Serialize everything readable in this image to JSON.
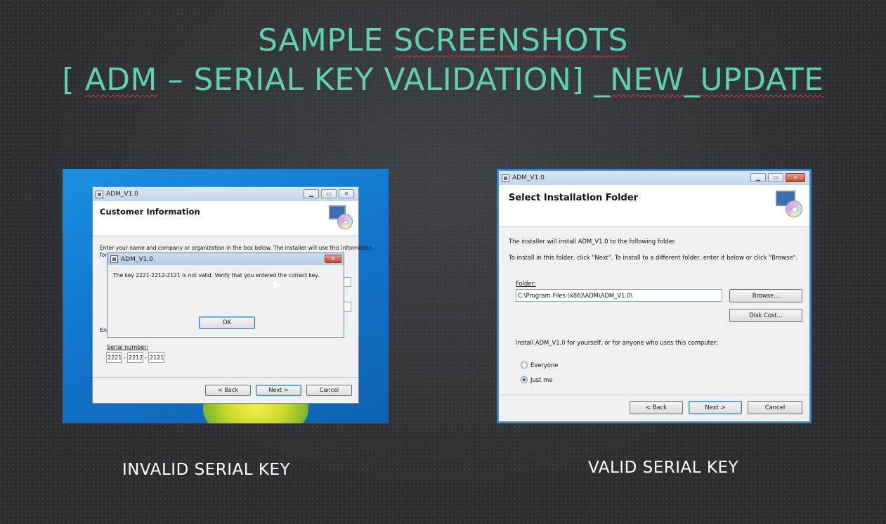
{
  "slide": {
    "title_line1_a": "Sample ",
    "title_line1_b": "Screenshots",
    "title_line2_a": "[ ",
    "title_line2_b": "ADM",
    "title_line2_c": " – Serial Key Validation] _",
    "title_line2_d": "NEW_UPDATE",
    "caption_left": "INVALID SERIAL KEY",
    "caption_right": "VALID SERIAL KEY",
    "accent_color": "#5fd1b3"
  },
  "left_shot": {
    "window_title": "ADM_V1.0",
    "header_title": "Customer Information",
    "intro_text": "Enter your name and company or organization in the box below. The installer will use this information",
    "intro_text_cont": "for",
    "entry_label_stub": "En",
    "serial_label": "Serial number:",
    "serial_parts": [
      "2221",
      "2212",
      "2121"
    ],
    "serial_sep": "-",
    "buttons": {
      "back": "< Back",
      "next": "Next >",
      "cancel": "Cancel"
    },
    "dialog": {
      "title": "ADM_V1.0",
      "message": "The key 2221-2212-2121 is not valid.  Verify that you entered the correct key.",
      "ok": "OK",
      "close_glyph": "✕"
    },
    "caption_buttons": {
      "minimize": "▁",
      "maximize": "▭",
      "close": "✕"
    }
  },
  "right_shot": {
    "window_title": "ADM_V1.0",
    "header_title": "Select Installation Folder",
    "line1": "The installer will install ADM_V1.0 to the following folder.",
    "line2": "To install in this folder, click \"Next\". To install to a different folder, enter it below or click \"Browse\".",
    "folder_label": "Folder:",
    "folder_value": "C:\\Program Files (x86)\\ADM\\ADM_V1.0\\",
    "browse": "Browse...",
    "disk_cost": "Disk Cost...",
    "install_for": "Install ADM_V1.0 for yourself, or for anyone who uses this computer:",
    "options": [
      {
        "label": "Everyone",
        "selected": false
      },
      {
        "label": "Just me",
        "selected": true
      }
    ],
    "buttons": {
      "back": "< Back",
      "next": "Next >",
      "cancel": "Cancel"
    },
    "caption_buttons": {
      "minimize": "▁",
      "maximize": "▭",
      "close": "✕"
    }
  }
}
